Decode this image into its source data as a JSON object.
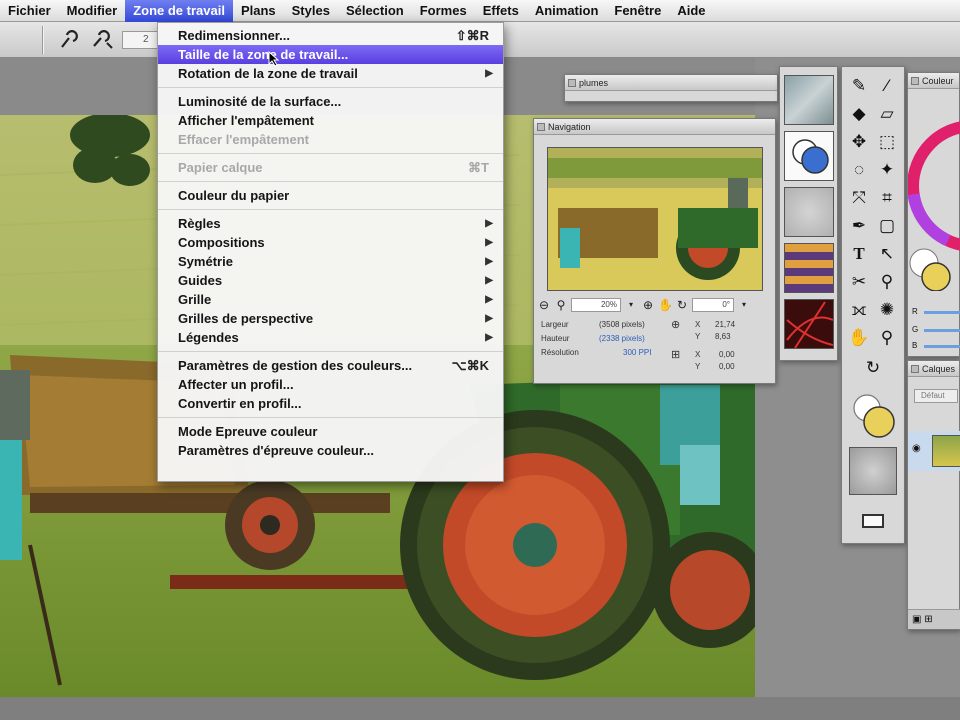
{
  "menubar": {
    "items": [
      {
        "label": "Fichier"
      },
      {
        "label": "Modifier"
      },
      {
        "label": "Zone de travail",
        "active": true
      },
      {
        "label": "Plans"
      },
      {
        "label": "Styles"
      },
      {
        "label": "Sélection"
      },
      {
        "label": "Formes"
      },
      {
        "label": "Effets"
      },
      {
        "label": "Animation"
      },
      {
        "label": "Fenêtre"
      },
      {
        "label": "Aide"
      }
    ]
  },
  "dropdown": {
    "items": [
      {
        "label": "Redimensionner...",
        "shortcut": "⇧⌘R"
      },
      {
        "label": "Taille de la zone de travail...",
        "highlight": true
      },
      {
        "label": "Rotation de la zone de travail",
        "submenu": true
      },
      {
        "label": "Luminosité de la surface..."
      },
      {
        "label": "Afficher l'empâtement"
      },
      {
        "label": "Effacer l'empâtement",
        "disabled": true
      },
      {
        "label": "Papier calque",
        "shortcut": "⌘T",
        "disabled": true
      },
      {
        "label": "Couleur du papier"
      },
      {
        "label": "Règles",
        "submenu": true
      },
      {
        "label": "Compositions",
        "submenu": true
      },
      {
        "label": "Symétrie",
        "submenu": true
      },
      {
        "label": "Guides",
        "submenu": true
      },
      {
        "label": "Grille",
        "submenu": true
      },
      {
        "label": "Grilles de perspective",
        "submenu": true
      },
      {
        "label": "Légendes",
        "submenu": true
      },
      {
        "label": "Paramètres de gestion des couleurs...",
        "shortcut": "⌥⌘K"
      },
      {
        "label": "Affecter un profil..."
      },
      {
        "label": "Convertir en profil..."
      },
      {
        "label": "Mode Epreuve couleur"
      },
      {
        "label": "Paramètres d'épreuve couleur..."
      }
    ]
  },
  "panels": {
    "navigation": {
      "title": "Navigation",
      "zoom": "20%",
      "rotation": "0°",
      "largeur_label": "Largeur",
      "largeur_value": "(3508 pixels)",
      "hauteur_label": "Hauteur",
      "hauteur_value": "(2338 pixels)",
      "resolution_label": "Résolution",
      "resolution_value": "300 PPI",
      "x_label": "X",
      "x_value": "21,74",
      "y_label": "Y",
      "y_value": "8,63",
      "x2_value": "0,00",
      "y2_value": "0,00"
    },
    "plumes": {
      "title": "plumes"
    },
    "color": {
      "title": "Couleur",
      "r": "R",
      "g": "G",
      "b": "B"
    },
    "layers": {
      "title": "Calques",
      "preset": "Défaut"
    }
  },
  "toolbar": {
    "field_value": "2"
  },
  "colors": {
    "menu_highlight": "#5a3fe0",
    "active_menu": "#3348d8",
    "main_color": "#e8d05a",
    "secondary_color": "#3a6fd0"
  }
}
